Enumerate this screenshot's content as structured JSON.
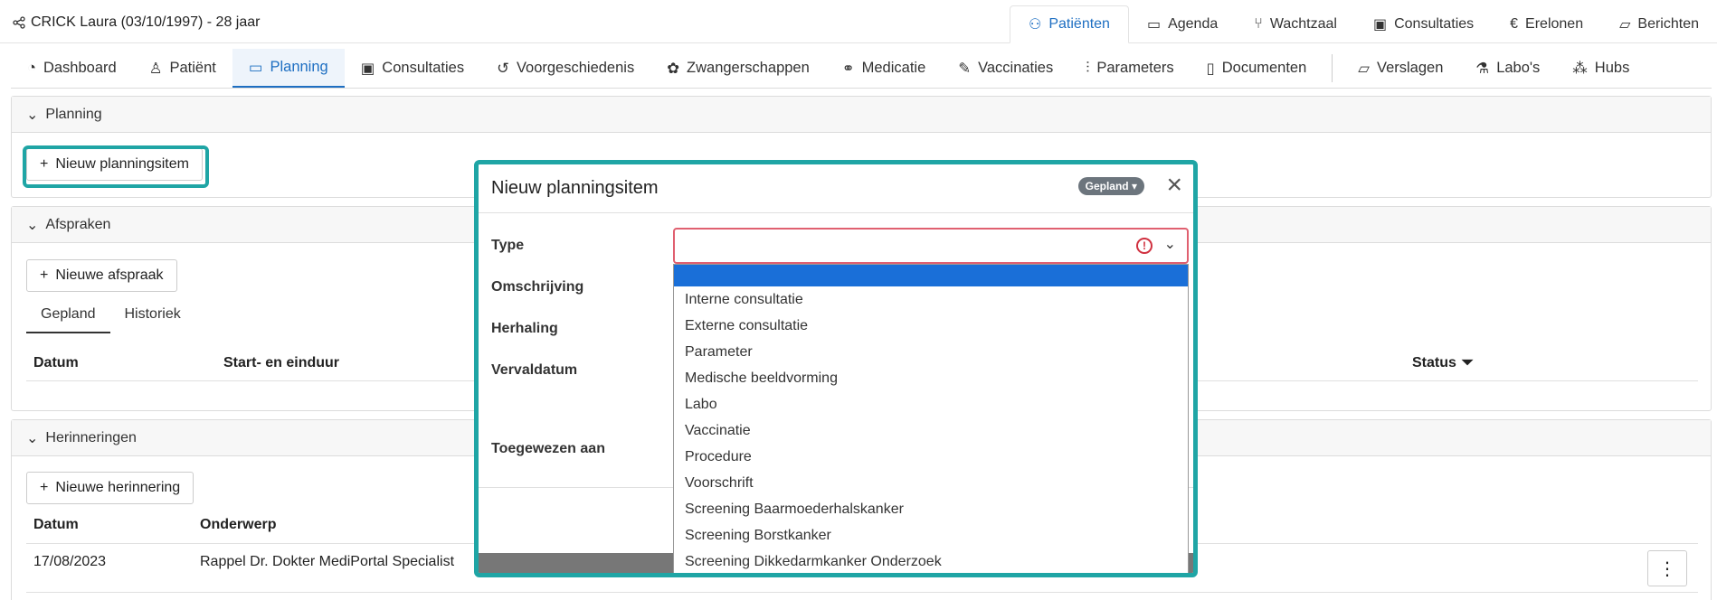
{
  "patient": {
    "name": "CRICK Laura (03/10/1997) - 28 jaar"
  },
  "topnav": [
    {
      "label": "Patiënten",
      "icon": "users-icon",
      "active": true
    },
    {
      "label": "Agenda",
      "icon": "calendar-icon"
    },
    {
      "label": "Wachtzaal",
      "icon": "chair-icon"
    },
    {
      "label": "Consultaties",
      "icon": "briefcase-icon"
    },
    {
      "label": "Erelonen",
      "icon": "euro-icon"
    },
    {
      "label": "Berichten",
      "icon": "inbox-icon"
    }
  ],
  "subnav": [
    {
      "label": "Dashboard",
      "icon": "dashboard-icon"
    },
    {
      "label": "Patiënt",
      "icon": "person-icon"
    },
    {
      "label": "Planning",
      "icon": "calendar-icon",
      "active": true
    },
    {
      "label": "Consultaties",
      "icon": "briefcase-icon"
    },
    {
      "label": "Voorgeschiedenis",
      "icon": "history-icon"
    },
    {
      "label": "Zwangerschappen",
      "icon": "pregnancy-icon"
    },
    {
      "label": "Medicatie",
      "icon": "pills-icon"
    },
    {
      "label": "Vaccinaties",
      "icon": "syringe-icon"
    },
    {
      "label": "Parameters",
      "icon": "chart-icon"
    },
    {
      "label": "Documenten",
      "icon": "document-icon"
    },
    {
      "label": "Verslagen",
      "icon": "inbox-icon"
    },
    {
      "label": "Labo's",
      "icon": "flask-icon"
    },
    {
      "label": "Hubs",
      "icon": "hubs-icon"
    }
  ],
  "planning": {
    "title": "Planning",
    "new_button": "Nieuw planningsitem"
  },
  "afspraken": {
    "title": "Afspraken",
    "new_button": "Nieuwe afspraak",
    "tabs": [
      "Gepland",
      "Historiek"
    ],
    "columns": {
      "datum": "Datum",
      "uur": "Start- en einduur",
      "status": "Status"
    }
  },
  "herinneringen": {
    "title": "Herinneringen",
    "new_button": "Nieuwe herinnering",
    "columns": {
      "datum": "Datum",
      "onderwerp": "Onderwerp"
    },
    "rows": [
      {
        "datum": "17/08/2023",
        "onderwerp": "Rappel Dr. Dokter MediPortal Specialist"
      }
    ]
  },
  "modal": {
    "title": "Nieuw planningsitem",
    "badge": "Gepland",
    "labels": {
      "type": "Type",
      "omschrijving": "Omschrijving",
      "herhaling": "Herhaling",
      "vervaldatum": "Vervaldatum",
      "toegewezen": "Toegewezen aan"
    },
    "options": [
      "",
      "Interne consultatie",
      "Externe consultatie",
      "Parameter",
      "Medische beeldvorming",
      "Labo",
      "Vaccinatie",
      "Procedure",
      "Voorschrift",
      "Screening Baarmoederhalskanker",
      "Screening Borstkanker",
      "Screening Dikkedarmkanker Onderzoek"
    ]
  },
  "colors": {
    "accent": "#1e6fc2",
    "highlight": "#1fa5a5",
    "selected": "#1a6fd8",
    "error": "#d0303f"
  }
}
